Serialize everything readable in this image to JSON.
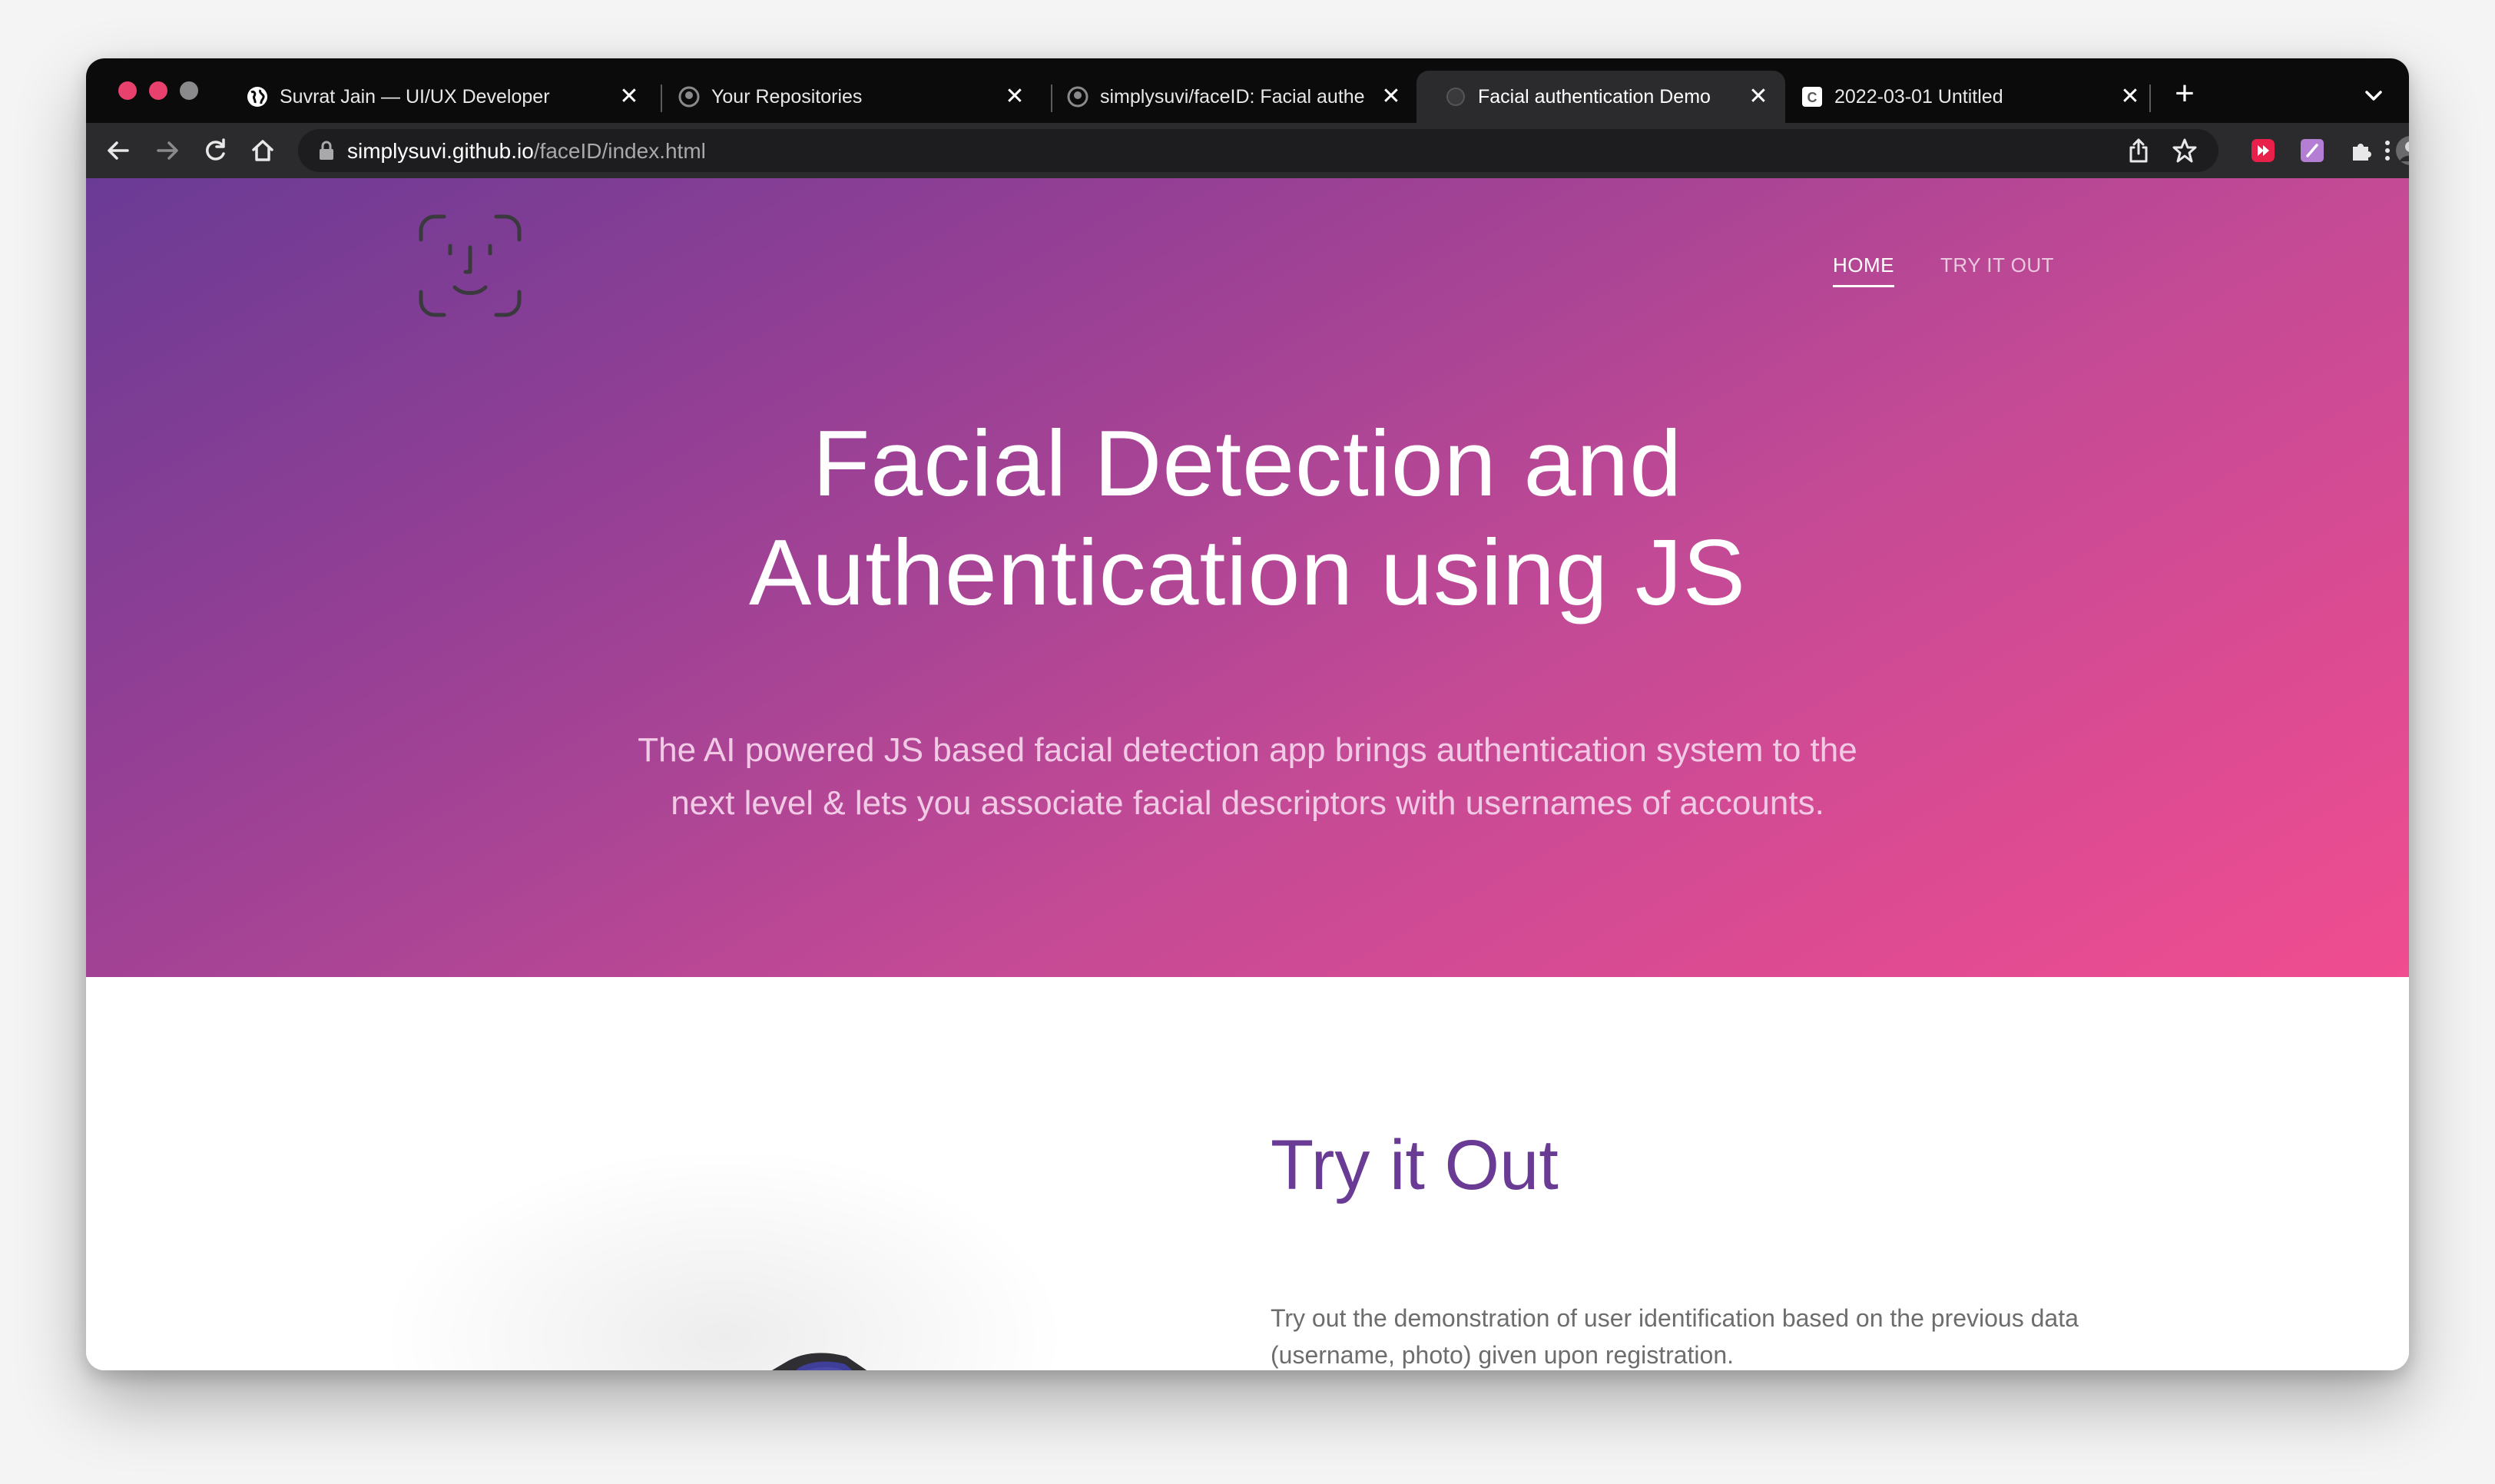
{
  "browser": {
    "tabs": [
      {
        "title": "Suvrat Jain — UI/UX Developer",
        "favicon": "globe-icon",
        "active": false
      },
      {
        "title": "Your Repositories",
        "favicon": "github-icon",
        "active": false
      },
      {
        "title": "simplysuvi/faceID: Facial authe",
        "favicon": "github-icon",
        "active": false
      },
      {
        "title": "Facial authentication Demo",
        "favicon": "page-icon",
        "active": true
      },
      {
        "title": "2022-03-01 Untitled",
        "favicon": "c-icon",
        "active": false
      }
    ],
    "new_tab_label": "+",
    "url_host": "simplysuvi.github.io",
    "url_path": "/faceID/index.html",
    "colors": {
      "tabbar_bg": "#0b0b0c",
      "toolbar_bg": "#2b2b2d",
      "traffic_lights": [
        "#e9416d",
        "#e9416d",
        "#8a8a8c"
      ]
    },
    "extensions": [
      "play-extension-icon",
      "note-extension-icon",
      "puzzle-icon",
      "profile-avatar"
    ]
  },
  "site": {
    "nav": {
      "home": "HOME",
      "try": "TRY IT OUT"
    },
    "hero": {
      "title_line1": "Facial Detection and",
      "title_line2": "Authentication using JS",
      "subtitle": "The AI powered JS based facial detection app brings authentication system to the next level & lets you associate facial descriptors with usernames of accounts."
    },
    "try_section": {
      "title": "Try it Out",
      "description": "Try out the demonstration of user identification based on the previous data (username, photo) given upon registration."
    },
    "colors": {
      "gradient_start": "#6a3b95",
      "gradient_end": "#f04c90",
      "accent_purple": "#6a3b95",
      "button_pink": "#e04593"
    }
  }
}
